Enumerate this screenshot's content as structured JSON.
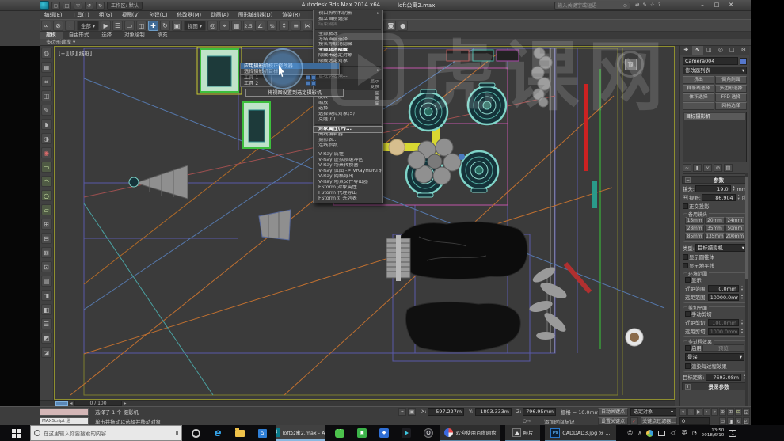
{
  "window": {
    "title": "Autodesk 3ds Max  2014 x64",
    "document": "loft公寓2.max",
    "workspace": "工作区: 默认",
    "search_placeholder": "输入关键字或短语",
    "min": "–",
    "max": "□",
    "close": "✕"
  },
  "menubar": {
    "items": [
      "编辑(E)",
      "工具(T)",
      "组(G)",
      "视图(V)",
      "创建(C)",
      "修改器(M)",
      "动画(A)",
      "图形编辑器(D)",
      "渲染(R)"
    ]
  },
  "toolbar": {
    "icons": [
      {
        "g": "∞",
        "n": "select-and-link-icon"
      },
      {
        "g": "⊘",
        "n": "unlink-selection-icon"
      },
      {
        "g": "≀",
        "n": "bind-to-spacewarp-icon"
      },
      {
        "g": "全部 ▾",
        "n": "selection-filter-dropdown",
        "cls": "combo"
      },
      {
        "g": "▶",
        "n": "select-object-icon"
      },
      {
        "g": "☰",
        "n": "select-by-name-icon"
      },
      {
        "g": "▭",
        "n": "selection-region-icon"
      },
      {
        "g": "◫",
        "n": "window-crossing-icon"
      },
      {
        "g": "✚",
        "n": "select-and-move-icon",
        "cls": "active"
      },
      {
        "g": "↻",
        "n": "select-and-rotate-icon"
      },
      {
        "g": "▣",
        "n": "select-and-scale-icon"
      },
      {
        "g": "视图 ▾",
        "n": "reference-coordinate-dropdown",
        "cls": "combo"
      },
      {
        "g": "◎",
        "n": "use-pivot-point-icon"
      },
      {
        "g": "⌖",
        "n": "select-and-manipulate-icon"
      },
      {
        "g": "▦",
        "n": "keyboard-override-icon"
      },
      {
        "g": "2.5",
        "n": "snaps-toggle-icon",
        "cls": "txt"
      },
      {
        "g": "∠",
        "n": "angle-snap-icon"
      },
      {
        "g": "%",
        "n": "percent-snap-icon",
        "cls": "txt"
      },
      {
        "g": "↕",
        "n": "spinner-snap-icon"
      },
      {
        "g": "≡",
        "n": "named-selection-icon"
      },
      {
        "g": "⋈",
        "n": "mirror-icon"
      },
      {
        "g": "∥",
        "n": "align-icon"
      },
      {
        "g": "▤",
        "n": "layer-manager-icon"
      },
      {
        "g": "∿",
        "n": "curve-editor-icon"
      },
      {
        "g": "▦",
        "n": "dope-sheet-icon"
      },
      {
        "g": "◐",
        "n": "material-editor-icon"
      },
      {
        "g": "⚙",
        "n": "render-setup-icon"
      },
      {
        "g": "◙",
        "n": "rendered-frame-icon"
      },
      {
        "g": "●",
        "n": "render-icon"
      }
    ]
  },
  "ribbon": {
    "tabs": [
      {
        "label": "建模",
        "cls": "active"
      },
      {
        "label": "自由形式"
      },
      {
        "label": "选择"
      },
      {
        "label": "对象绘制"
      },
      {
        "label": "填充"
      }
    ],
    "panel_label": "多边形建模 ▾"
  },
  "left_toolbar": {
    "icons": [
      {
        "g": "◍"
      },
      {
        "g": "▦"
      },
      {
        "g": "⌗"
      },
      {
        "g": "◫"
      },
      {
        "g": "✎"
      },
      {
        "g": "◗"
      },
      {
        "g": "◑"
      },
      {
        "g": "◉",
        "cls": "red"
      },
      {
        "g": "▭",
        "cls": "green"
      },
      {
        "g": "◠",
        "cls": "green"
      },
      {
        "g": "○",
        "cls": "green"
      },
      {
        "g": "▱",
        "cls": "green"
      },
      {
        "g": "⊞"
      },
      {
        "g": "⊟"
      },
      {
        "g": "⊠"
      },
      {
        "g": "⊡"
      },
      {
        "g": "▤"
      },
      {
        "g": "◨"
      },
      {
        "g": "◧"
      },
      {
        "g": "☰"
      },
      {
        "g": "◩"
      },
      {
        "g": "◪"
      }
    ]
  },
  "viewport": {
    "label": "[+][顶][线框]",
    "viewcube": "顶",
    "time": "0 / 100"
  },
  "context_menu": {
    "items": [
      {
        "label": "视口照明和阴影",
        "arrow": "▸"
      },
      {
        "label": "孤立当前选择"
      },
      {
        "label": "结束隔离",
        "cls": "disabled"
      },
      {
        "cls": "sep"
      },
      {
        "label": "全部解冻"
      },
      {
        "label": "冻结当前选择"
      },
      {
        "label": "按名称取消隐藏"
      },
      {
        "label": "全部取消隐藏",
        "cls": "bold"
      },
      {
        "label": "隐藏未选定对象"
      },
      {
        "label": "隐藏选定对象"
      },
      {
        "cls": "sep"
      },
      {
        "label": "状态集",
        "arrow": "▸"
      },
      {
        "label": "管理状态集..."
      },
      {
        "label": "显示",
        "cls": "header"
      },
      {
        "label": "变换",
        "cls": "header"
      },
      {
        "label": "移动",
        "right": "▪"
      },
      {
        "label": "旋转",
        "right": "▪"
      },
      {
        "label": "缩放",
        "right": "▪"
      },
      {
        "label": "选择"
      },
      {
        "label": "选择类似对象(S)"
      },
      {
        "label": "克隆(C)"
      },
      {
        "cls": "sep"
      },
      {
        "label": "对象属性(P)...",
        "cls": "boldbox"
      },
      {
        "label": "曲线编辑器..."
      },
      {
        "label": "摄影表..."
      },
      {
        "label": "连线参数..."
      },
      {
        "cls": "sep"
      },
      {
        "label": "V-Ray 属性"
      },
      {
        "label": "V-Ray 虚拟帧缓冲区"
      },
      {
        "label": "V-Ray 场景转换器"
      },
      {
        "label": "V-Ray 位图 -> VRayHDRI 转换器"
      },
      {
        "label": "V-Ray 网格导出"
      },
      {
        "label": "V-Ray 场景文件导出器"
      },
      {
        "label": "FStorm 对象属性"
      },
      {
        "label": "FStorm 代理导出"
      },
      {
        "label": "FStorm 灯光列表"
      }
    ]
  },
  "camera_menu": {
    "items": [
      {
        "label": "应用摄影机校正修改器",
        "cls": "hilite"
      },
      {
        "label": "选择摄影机目标"
      }
    ],
    "tools": [
      {
        "label": "工具 1"
      },
      {
        "label": "工具 2"
      }
    ],
    "tooltip": "将视图设置到选定摄影机"
  },
  "command_panel": {
    "tabs": [
      {
        "g": "✚",
        "n": "tab-create"
      },
      {
        "g": "∿",
        "n": "tab-modify",
        "cls": "active"
      },
      {
        "g": "◫",
        "n": "tab-hierarchy"
      },
      {
        "g": "◎",
        "n": "tab-motion"
      },
      {
        "g": "□",
        "n": "tab-display"
      },
      {
        "g": "⚙",
        "n": "tab-utilities"
      }
    ],
    "object_name": "Camera004",
    "modifier_list": "修改器列表",
    "modifier_buttons": [
      "挤出",
      "倒角剖面",
      "样条线选择",
      "多边形选择",
      "体积选择",
      "FFD 选择",
      "",
      "网格选择"
    ],
    "stack_item": "目标摄影机",
    "stack_icons": [
      {
        "g": "~",
        "n": "pin-stack-icon"
      },
      {
        "g": "▮",
        "n": "show-end-result-icon"
      },
      {
        "g": "⋎",
        "n": "make-unique-icon"
      },
      {
        "g": "⊘",
        "n": "remove-modifier-icon"
      },
      {
        "g": "▤",
        "n": "configure-modifier-sets-icon"
      }
    ],
    "params": {
      "title": "参数",
      "lens_label": "镜头:",
      "lens_value": "19.0",
      "lens_unit": "mm",
      "fov_label": "视野:",
      "fov_value": "86.904",
      "fov_unit": "度",
      "ortho_label": "正交投影",
      "stock_title": "备用镜头",
      "stock_lenses": [
        "15mm",
        "20mm",
        "24mm",
        "28mm",
        "35mm",
        "50mm",
        "85mm",
        "135mm",
        "200mm"
      ],
      "type_label": "类型:",
      "type_value": "目标摄影机",
      "show_cone_label": "显示圆锥体",
      "show_horizon_label": "显示地平线",
      "env_title": "环境范围",
      "env_show_label": "显示",
      "near_label": "近距范围:",
      "near_value": "0.0mm",
      "far_label": "远距范围:",
      "far_value": "10000.0mm",
      "clip_title": "剪切平面",
      "clip_manual_label": "手动剪切",
      "clip_near_label": "近距剪切:",
      "clip_near_value": "100.0mm",
      "clip_far_label": "远距剪切:",
      "clip_far_value": "1000.0mm",
      "multipass_title": "多过程效果",
      "enable_label": "启用",
      "preview_label": "预览",
      "effect_value": "景深",
      "render_pass_label": "渲染每过程效果",
      "target_label": "目标距离:",
      "target_value": "7693.08m",
      "dof_title": "景深参数"
    }
  },
  "status_bar": {
    "listener_input": "MAXScript 迷",
    "selected_info": "选择了 1 个 摄影机",
    "prompt": "单击并拖动以选择并移动对象",
    "x_label": "X:",
    "x_value": "-597.227m",
    "y_label": "Y:",
    "y_value": "1803.333m",
    "z_label": "Z:",
    "z_value": "796.95mm",
    "grid_info": "栅格 = 10.0mm",
    "key_link": "O⇾",
    "auto_key": "自动关键点",
    "set_key": "设置关键点",
    "selection_set": "选定对象",
    "key_filters": "关键点过滤器...",
    "add_time_tag": "添加时间标记",
    "frame": "0",
    "playback": [
      {
        "g": "«",
        "n": "go-to-start-button"
      },
      {
        "g": "‹",
        "n": "previous-frame-button"
      },
      {
        "g": "▶",
        "n": "play-button"
      },
      {
        "g": "›",
        "n": "next-frame-button"
      },
      {
        "g": "»",
        "n": "go-to-end-button"
      }
    ],
    "nav_row1": [
      {
        "g": "⊕",
        "n": "zoom-icon"
      },
      {
        "g": "⊞",
        "n": "zoom-all-icon"
      },
      {
        "g": "⊡",
        "n": "zoom-extents-icon",
        "cls": "lit"
      },
      {
        "g": "◱",
        "n": "zoom-region-icon"
      }
    ],
    "nav_row2": [
      {
        "g": "▭",
        "n": "fov-icon"
      },
      {
        "g": "◨",
        "n": "pan-icon"
      },
      {
        "g": "↻",
        "n": "orbit-icon"
      },
      {
        "g": "◰",
        "n": "maximize-viewport-icon"
      }
    ]
  },
  "taskbar": {
    "search_placeholder": "在这里输入你要搜索的内容",
    "max_window": "loft公寓2.max - A...",
    "baidu_label": "欢迎使用百度网盘",
    "photos_label": "照片",
    "ps_label": "CADDAD3.jpg @ ...",
    "lang": "英",
    "time": "13:50",
    "date": "2018/6/10",
    "badge": "1"
  },
  "watermark": {
    "text": "虎课网"
  }
}
